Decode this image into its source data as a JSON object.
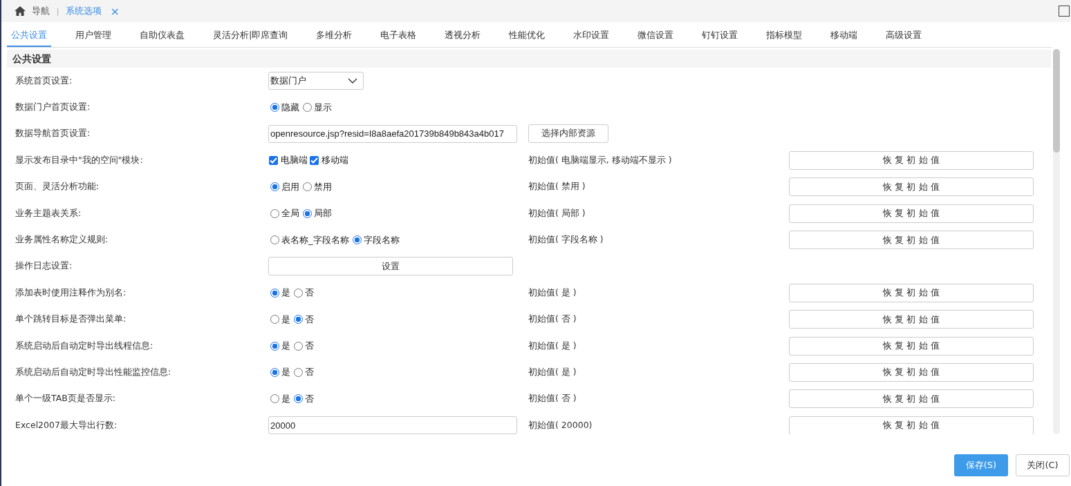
{
  "breadcrumb": {
    "home": "导航",
    "separator": "|",
    "current": "系统选项",
    "close": "×"
  },
  "tabs": [
    {
      "label": "公共设置",
      "selected": true
    },
    {
      "label": "用户管理",
      "selected": false
    },
    {
      "label": "自助仪表盘",
      "selected": false
    },
    {
      "label": "灵活分析|即席查询",
      "selected": false
    },
    {
      "label": "多维分析",
      "selected": false
    },
    {
      "label": "电子表格",
      "selected": false
    },
    {
      "label": "透视分析",
      "selected": false
    },
    {
      "label": "性能优化",
      "selected": false
    },
    {
      "label": "水印设置",
      "selected": false
    },
    {
      "label": "微信设置",
      "selected": false
    },
    {
      "label": "钉钉设置",
      "selected": false
    },
    {
      "label": "指标模型",
      "selected": false
    },
    {
      "label": "移动端",
      "selected": false
    },
    {
      "label": "高级设置",
      "selected": false
    }
  ],
  "section_title": "公共设置",
  "rows": [
    {
      "kind": "select",
      "label": "系统首页设置:",
      "value": "数据门户"
    },
    {
      "kind": "radio",
      "label": "数据门户首页设置:",
      "options": [
        {
          "label": "隐藏",
          "selected": true
        },
        {
          "label": "显示",
          "selected": false
        }
      ]
    },
    {
      "kind": "text",
      "label": "数据导航首页设置:",
      "value": "openresource.jsp?resid=I8a8aefa201739b849b843a4b017",
      "button": "选择内部资源"
    },
    {
      "kind": "checkbox",
      "label": "显示发布目录中\"我的空间\"模块:",
      "options": [
        {
          "label": "电脑端",
          "checked": true
        },
        {
          "label": "移动端",
          "checked": true
        }
      ],
      "initial": "初始值( 电脑端显示, 移动端不显示 )",
      "reset": "恢 复 初 始 值"
    },
    {
      "kind": "radio",
      "label": "页面、灵活分析功能:",
      "options": [
        {
          "label": "启用",
          "selected": true
        },
        {
          "label": "禁用",
          "selected": false
        }
      ],
      "initial": "初始值( 禁用 )",
      "reset": "恢 复 初 始 值"
    },
    {
      "kind": "radio",
      "label": "业务主题表关系:",
      "options": [
        {
          "label": "全局",
          "selected": false
        },
        {
          "label": "局部",
          "selected": true
        }
      ],
      "initial": "初始值( 局部 )",
      "reset": "恢 复 初 始 值"
    },
    {
      "kind": "radio",
      "label": "业务属性名称定义规则:",
      "options": [
        {
          "label": "表名称_字段名称",
          "selected": false
        },
        {
          "label": "字段名称",
          "selected": true
        }
      ],
      "initial": "初始值( 字段名称 )",
      "reset": "恢 复 初 始 值"
    },
    {
      "kind": "button",
      "label": "操作日志设置:",
      "button": "设置"
    },
    {
      "kind": "radio",
      "label": "添加表时使用注释作为别名:",
      "options": [
        {
          "label": "是",
          "selected": true
        },
        {
          "label": "否",
          "selected": false
        }
      ],
      "initial": "初始值( 是 )",
      "reset": "恢 复 初 始 值"
    },
    {
      "kind": "radio",
      "label": "单个跳转目标是否弹出菜单:",
      "options": [
        {
          "label": "是",
          "selected": false
        },
        {
          "label": "否",
          "selected": true
        }
      ],
      "initial": "初始值( 否 )",
      "reset": "恢 复 初 始 值"
    },
    {
      "kind": "radio",
      "label": "系统启动后自动定时导出线程信息:",
      "options": [
        {
          "label": "是",
          "selected": true
        },
        {
          "label": "否",
          "selected": false
        }
      ],
      "initial": "初始值( 是 )",
      "reset": "恢 复 初 始 值"
    },
    {
      "kind": "radio",
      "label": "系统启动后自动定时导出性能监控信息:",
      "options": [
        {
          "label": "是",
          "selected": true
        },
        {
          "label": "否",
          "selected": false
        }
      ],
      "initial": "初始值( 是 )",
      "reset": "恢 复 初 始 值"
    },
    {
      "kind": "radio",
      "label": "单个一级TAB页是否显示:",
      "options": [
        {
          "label": "是",
          "selected": false
        },
        {
          "label": "否",
          "selected": true
        }
      ],
      "initial": "初始值( 否 )",
      "reset": "恢 复 初 始 值"
    },
    {
      "kind": "text",
      "label": "Excel2007最大导出行数:",
      "value": "20000",
      "initial": "初始值( 20000)",
      "reset": "恢 复 初 始 值"
    }
  ],
  "footer": {
    "save": "保存(S)",
    "close": "关闭(C)"
  }
}
